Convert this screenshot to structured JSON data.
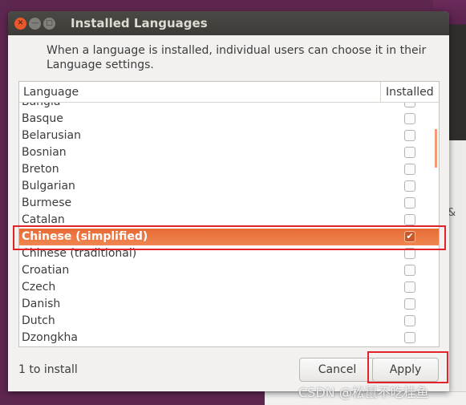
{
  "window": {
    "title": "Installed Languages",
    "close_icon": "close-icon",
    "minimize_icon": "minimize-icon",
    "maximize_icon": "maximize-icon"
  },
  "description": "When a language is installed, individual users can choose it in their Language settings.",
  "table": {
    "headers": {
      "language": "Language",
      "installed": "Installed"
    },
    "rows": [
      {
        "name": "Bangla",
        "installed": false
      },
      {
        "name": "Basque",
        "installed": false
      },
      {
        "name": "Belarusian",
        "installed": false
      },
      {
        "name": "Bosnian",
        "installed": false
      },
      {
        "name": "Breton",
        "installed": false
      },
      {
        "name": "Bulgarian",
        "installed": false
      },
      {
        "name": "Burmese",
        "installed": false
      },
      {
        "name": "Catalan",
        "installed": false
      },
      {
        "name": "Chinese (simplified)",
        "installed": true,
        "selected": true
      },
      {
        "name": "Chinese (traditional)",
        "installed": false
      },
      {
        "name": "Croatian",
        "installed": false
      },
      {
        "name": "Czech",
        "installed": false
      },
      {
        "name": "Danish",
        "installed": false
      },
      {
        "name": "Dutch",
        "installed": false
      },
      {
        "name": "Dzongkha",
        "installed": false
      }
    ]
  },
  "status": "1 to install",
  "buttons": {
    "cancel": "Cancel",
    "apply": "Apply"
  },
  "watermark": "CSDN @松鼠不吃桂鱼",
  "background_text": "&",
  "colors": {
    "accent": "#e95420",
    "highlight_box": "#e3222a"
  }
}
